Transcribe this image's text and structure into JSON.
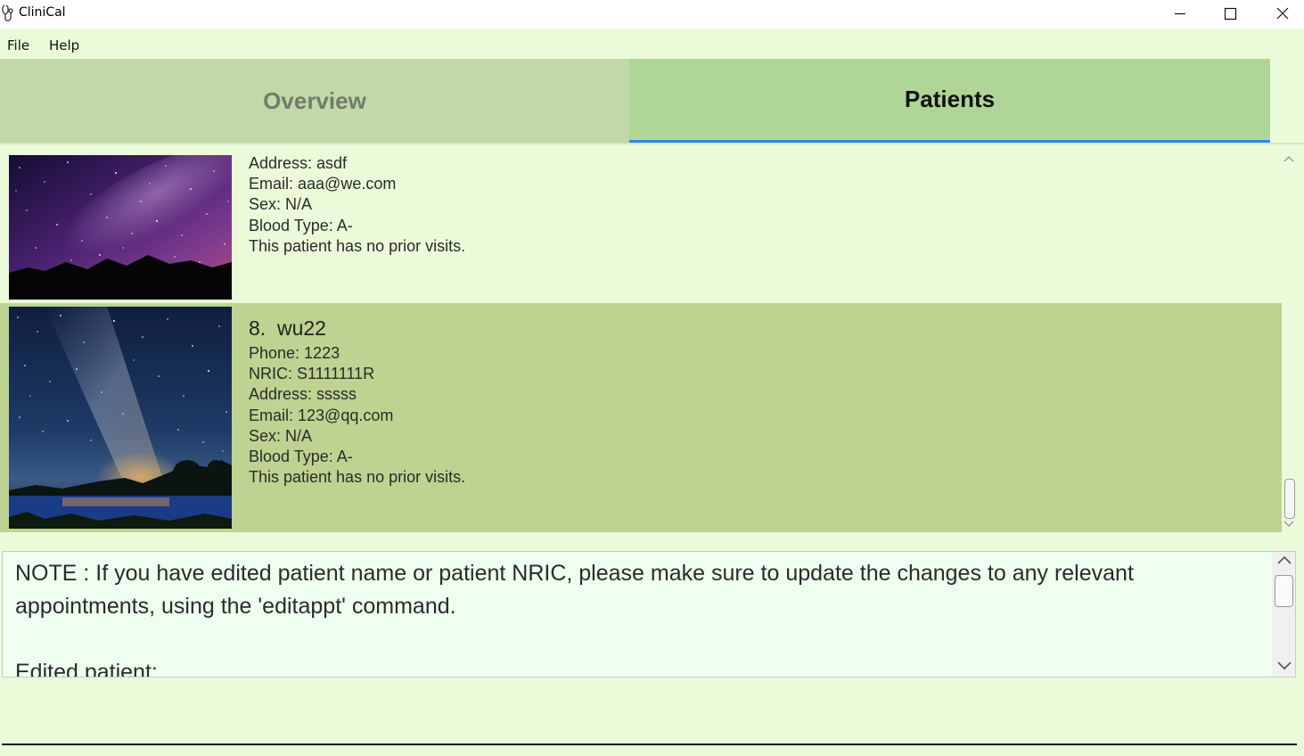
{
  "window": {
    "title": "CliniCal",
    "app_icon": "stethoscope-icon",
    "controls": [
      "minimize-icon",
      "maximize-icon",
      "close-icon"
    ]
  },
  "menu": {
    "file": "File",
    "help": "Help"
  },
  "tabs": {
    "overview": "Overview",
    "patients": "Patients",
    "active": "Patients"
  },
  "patients": {
    "card7": {
      "image": "purple night sky over mountains",
      "address": "Address: asdf",
      "email": "Email: aaa@we.com",
      "sex": "Sex: N/A",
      "blood": "Blood Type: A-",
      "visits": "This patient has no prior visits."
    },
    "card8": {
      "image": "milky way over lake",
      "index": "8.",
      "name": "wu22",
      "phone": "Phone: 1223",
      "nric": "NRIC: S1111111R",
      "address": "Address: sssss",
      "email": "Email: 123@qq.com",
      "sex": "Sex: N/A",
      "blood": "Blood Type: A-",
      "visits": "This patient has no prior visits."
    }
  },
  "result": {
    "note": "NOTE : If you have edited patient name or patient NRIC, please make sure to update the changes to any relevant appointments, using the 'editappt' command.",
    "edited": "Edited patient:"
  },
  "colors": {
    "background": "#ebfbda",
    "tab_inactive": "#c1d8a8",
    "tab_active": "#b0d697",
    "tab_underline": "#2b8be0",
    "selected_card": "#bed391",
    "result_box": "#eefff0"
  }
}
